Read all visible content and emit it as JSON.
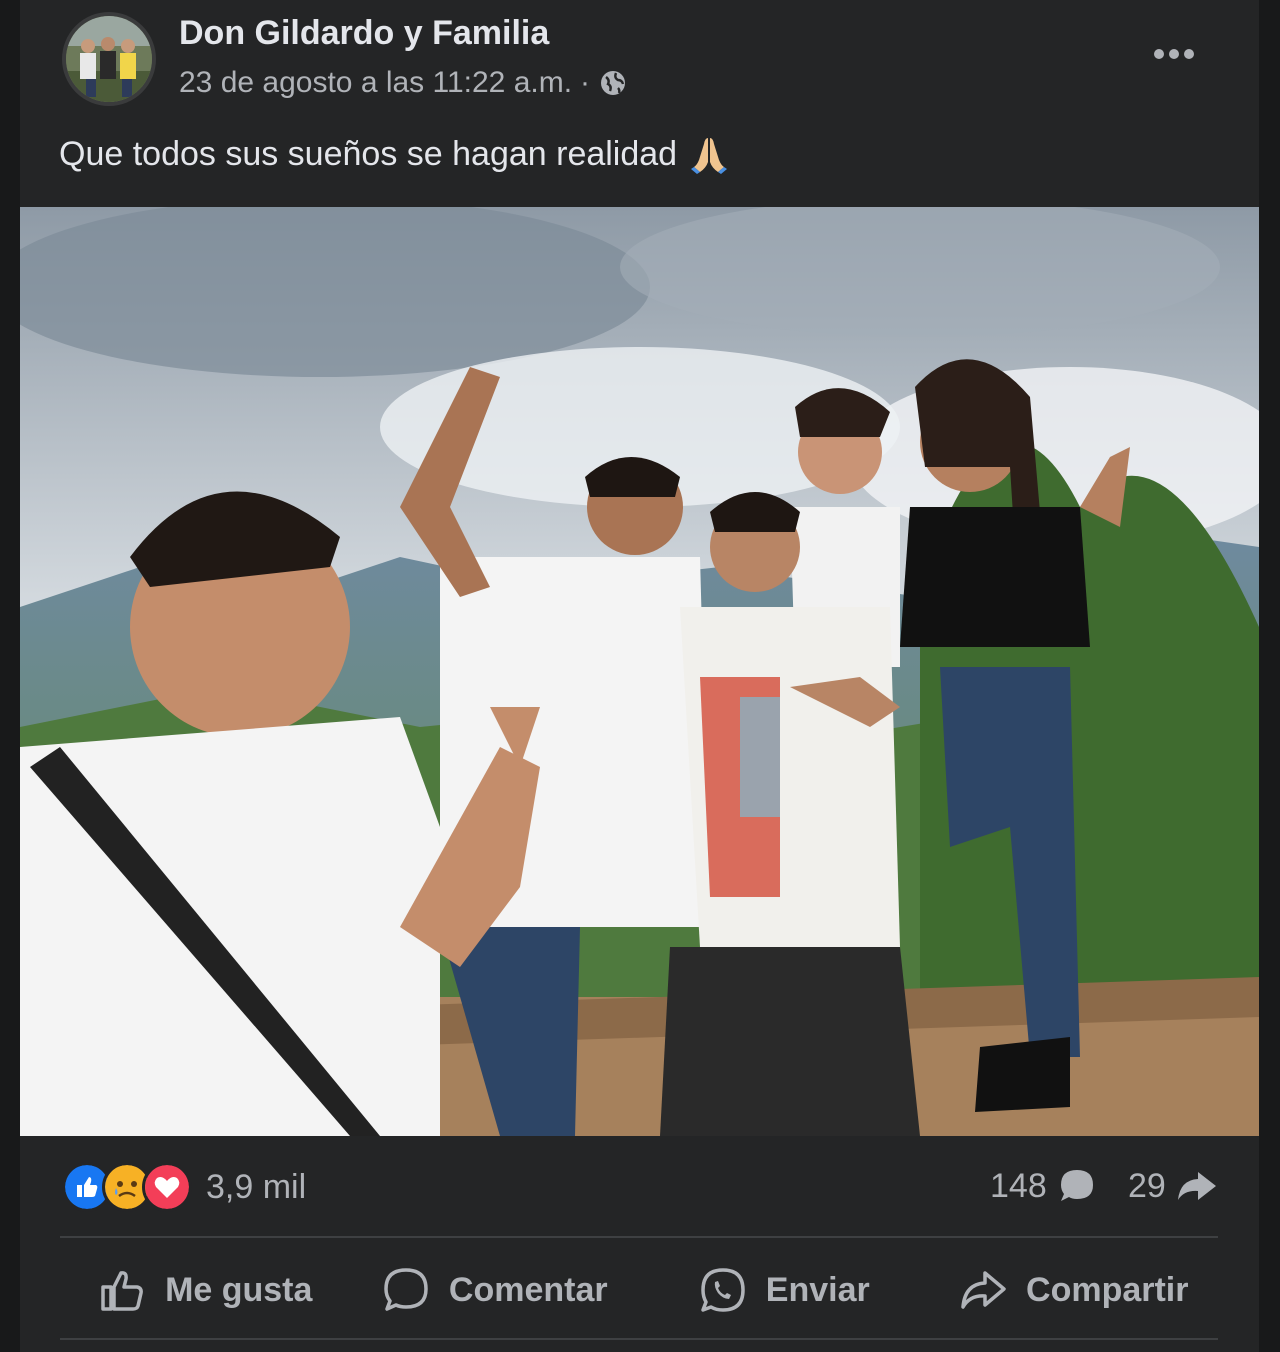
{
  "post": {
    "author": "Don Gildardo y Familia",
    "timestamp": "23 de agosto a las 11:22 a.m.",
    "separator": "·",
    "privacy_icon": "globe-icon",
    "more_icon": "more-options-icon",
    "caption": "Que todos sus sueños se hagan realidad",
    "caption_emoji": "folded-hands-emoji"
  },
  "stats": {
    "reactions": [
      "like",
      "sad",
      "love"
    ],
    "reaction_count": "3,9 mil",
    "comment_count": "148",
    "share_count": "29"
  },
  "actions": {
    "like": "Me gusta",
    "comment": "Comentar",
    "send": "Enviar",
    "share": "Compartir"
  },
  "colors": {
    "background": "#18191a",
    "card": "#242526",
    "primary_text": "#e4e6eb",
    "secondary_text": "#b0b3b8",
    "like_blue": "#1877f2",
    "love_red": "#f33e58",
    "sad_yellow": "#f7b125"
  }
}
